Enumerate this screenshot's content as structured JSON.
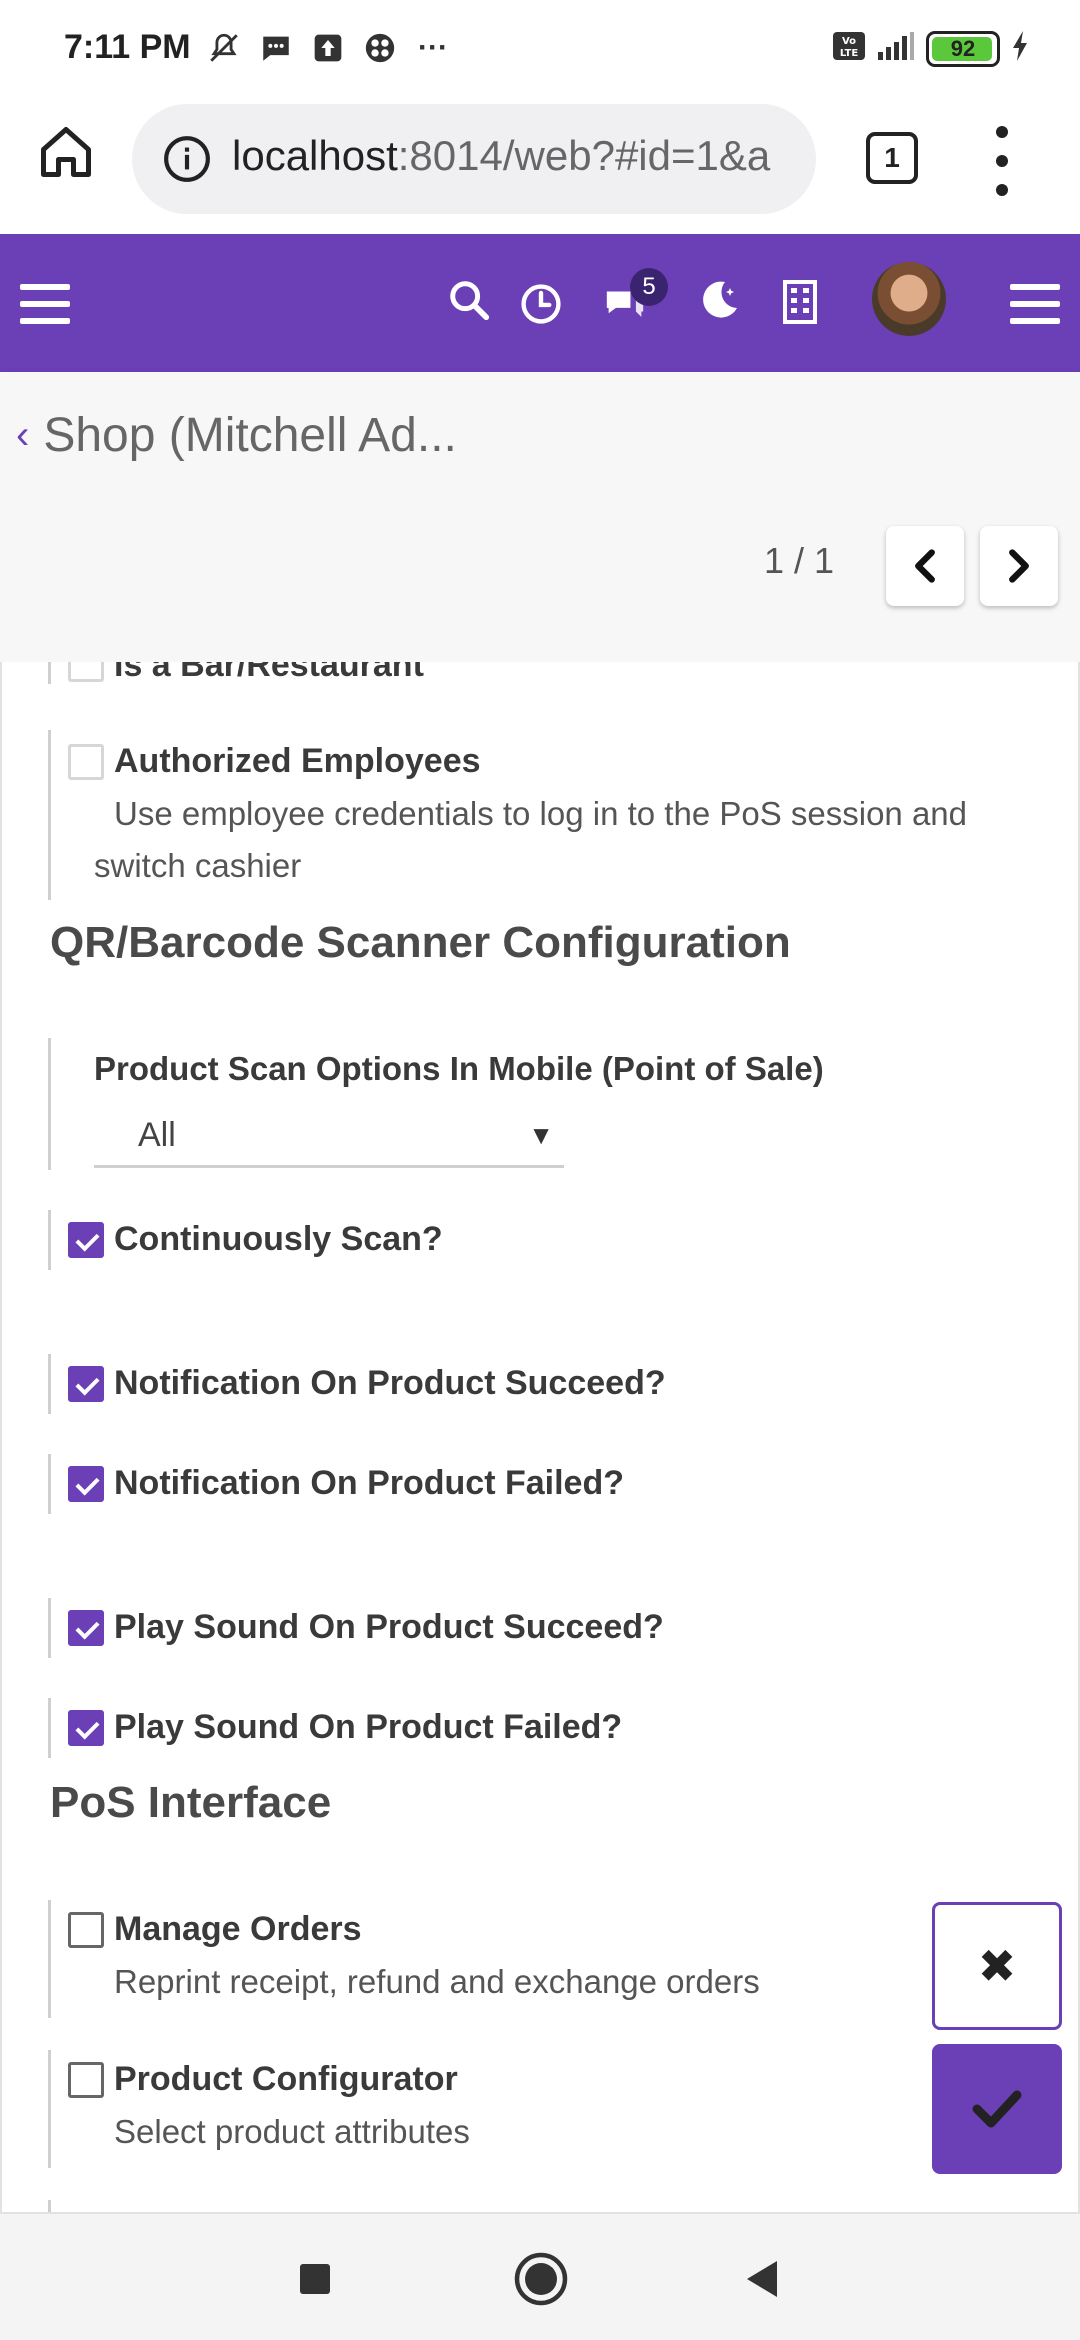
{
  "status_bar": {
    "time": "7:11 PM",
    "more": "···",
    "battery_level": "92",
    "icons": [
      "mute-icon",
      "message-icon",
      "upload-icon",
      "app-icon",
      "volte-icon",
      "signal-icon",
      "battery-icon",
      "charging-icon"
    ]
  },
  "browser": {
    "url_host": "localhost",
    "url_rest": ":8014/web?#id=1&a",
    "tab_count": "1"
  },
  "navbar": {
    "icons": [
      "menu-icon",
      "search-icon",
      "activity-clock-icon",
      "discuss-icon",
      "theme-moon-icon",
      "company-icon",
      "avatar",
      "apps-menu-icon"
    ],
    "message_count": "5",
    "accent_color": "#6b3fb5"
  },
  "control_panel": {
    "back_symbol": "‹",
    "title": "Shop (Mitchell Ad...",
    "pager": "1 / 1"
  },
  "form": {
    "cut_off_label": "Is a Bar/Restaurant",
    "authorized_employees": {
      "label": "Authorized Employees",
      "description": "Use employee credentials to log in to the PoS session and switch cashier",
      "checked": false
    },
    "scanner_section_title": "QR/Barcode Scanner Configuration",
    "scan_options": {
      "label": "Product Scan Options In Mobile (Point of Sale)",
      "value": "All"
    },
    "checkboxes": [
      {
        "label": "Continuously Scan?",
        "checked": true
      },
      {
        "label": "Notification On Product Succeed?",
        "checked": true
      },
      {
        "label": "Notification On Product Failed?",
        "checked": true
      },
      {
        "label": "Play Sound On Product Succeed?",
        "checked": true
      },
      {
        "label": "Play Sound On Product Failed?",
        "checked": true
      }
    ],
    "pos_section_title": "PoS Interface",
    "manage_orders": {
      "label": "Manage Orders",
      "description": "Reprint receipt, refund and exchange orders",
      "checked": false
    },
    "product_configurator": {
      "label": "Product Configurator",
      "description": "Select product attributes",
      "checked": false
    }
  },
  "actions": {
    "discard_symbol": "✖",
    "save_icon": "check-icon"
  },
  "system_nav": [
    "recents-button",
    "home-button",
    "back-button"
  ]
}
